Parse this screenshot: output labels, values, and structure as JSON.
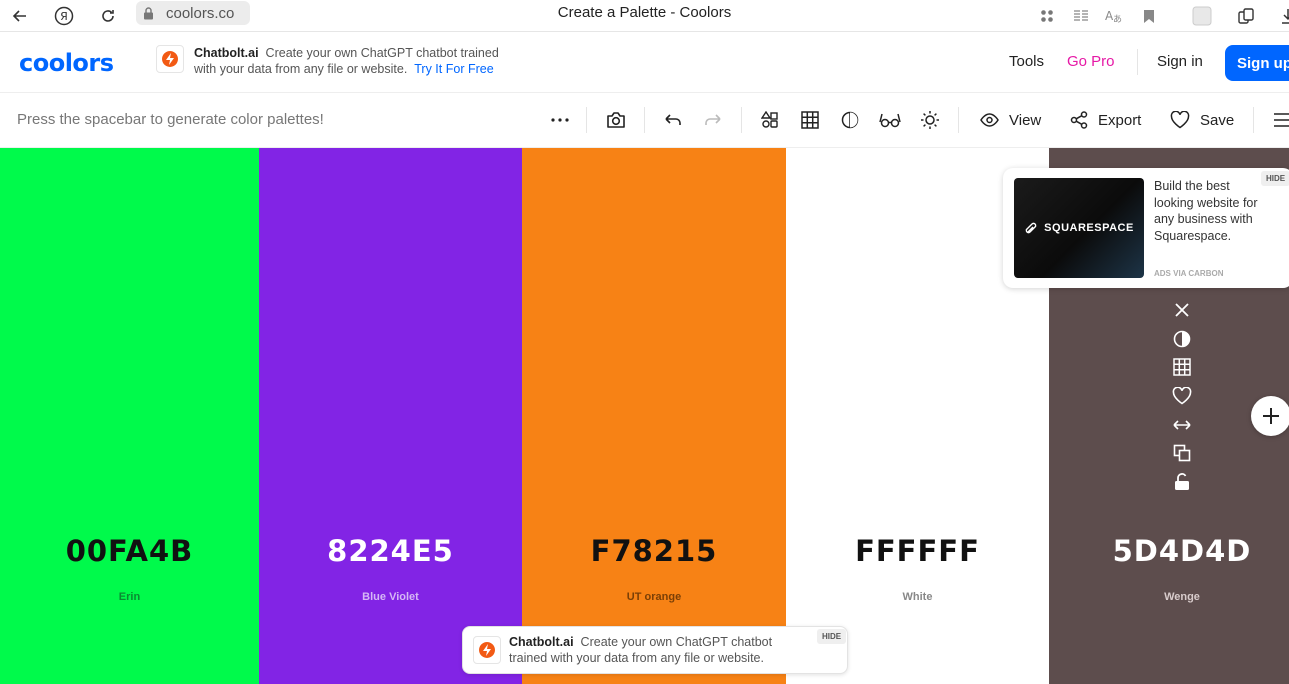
{
  "browser": {
    "url": "coolors.co",
    "tab_title": "Create a Palette - Coolors"
  },
  "header": {
    "logo": "coolors",
    "promo_brand": "Chatbolt.ai",
    "promo_line1": "Create your own ChatGPT chatbot trained",
    "promo_line2": "with your data from any file or website.",
    "promo_link": "Try It For Free",
    "tools": "Tools",
    "go_pro": "Go Pro",
    "sign_in": "Sign in",
    "sign_up": "Sign up"
  },
  "toolbar": {
    "hint": "Press the spacebar to generate color palettes!",
    "view": "View",
    "export": "Export",
    "save": "Save"
  },
  "palette": [
    {
      "hex": "00FA4B",
      "name": "Erin",
      "color": "#00FA4B",
      "text": "#111111",
      "name_color": "#0a8a32"
    },
    {
      "hex": "8224E5",
      "name": "Blue Violet",
      "color": "#8224E5",
      "text": "#ffffff",
      "name_color": "#d5b7f5"
    },
    {
      "hex": "F78215",
      "name": "UT orange",
      "color": "#F78215",
      "text": "#111111",
      "name_color": "#7a3f06"
    },
    {
      "hex": "FFFFFF",
      "name": "White",
      "color": "#FFFFFF",
      "text": "#111111",
      "name_color": "#888888"
    },
    {
      "hex": "5D4D4D",
      "name": "Wenge",
      "color": "#5D4D4D",
      "text": "#ffffff",
      "name_color": "#d8cccc"
    }
  ],
  "ad": {
    "brand": "SQUARESPACE",
    "text": "Build the best looking website for any business with Squarespace.",
    "via": "ADS VIA CARBON",
    "hide": "HIDE"
  },
  "bottom_promo": {
    "brand": "Chatbolt.ai",
    "text": "Create your own ChatGPT chatbot trained with your data from any file or website.",
    "hide": "HIDE"
  },
  "colors": {
    "brand_blue": "#0066ff",
    "go_pro_pink": "#e619a6"
  }
}
